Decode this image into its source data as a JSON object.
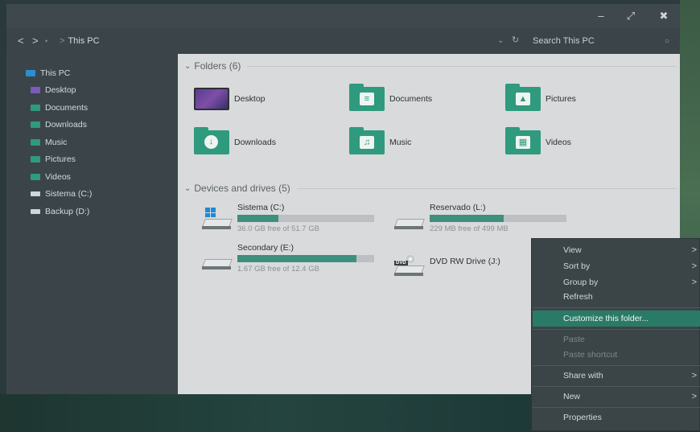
{
  "window": {
    "minimize": "–",
    "maximize": "⤢",
    "close": "✖"
  },
  "address": {
    "back": "<",
    "forward": ">",
    "up": "•",
    "sep": ">",
    "path": "This PC",
    "search_placeholder": "Search This PC"
  },
  "sidebar": {
    "items": [
      {
        "label": "This PC",
        "color": "#2a8fd0"
      },
      {
        "label": "Desktop",
        "color": "#7b5ac0"
      },
      {
        "label": "Documents",
        "color": "#2f9a7d"
      },
      {
        "label": "Downloads",
        "color": "#2f9a7d"
      },
      {
        "label": "Music",
        "color": "#2f9a7d"
      },
      {
        "label": "Pictures",
        "color": "#2f9a7d"
      },
      {
        "label": "Videos",
        "color": "#2f9a7d"
      },
      {
        "label": "Sistema (C:)",
        "color": "#d0d6d8"
      },
      {
        "label": "Backup (D:)",
        "color": "#d0d6d8"
      }
    ]
  },
  "folders": {
    "header": "Folders (6)",
    "items": [
      {
        "label": "Desktop",
        "icon": "desktop-icon"
      },
      {
        "label": "Documents",
        "icon": "document-icon"
      },
      {
        "label": "Pictures",
        "icon": "picture-icon"
      },
      {
        "label": "Downloads",
        "icon": "download-icon"
      },
      {
        "label": "Music",
        "icon": "music-icon"
      },
      {
        "label": "Videos",
        "icon": "video-icon"
      }
    ]
  },
  "drives": {
    "header": "Devices and drives (5)",
    "items": [
      {
        "name": "Sistema (C:)",
        "free": "36.0 GB free of 51.7 GB",
        "used_fraction": 0.3
      },
      {
        "name": "Reservado (L:)",
        "free": "229 MB free of 499 MB",
        "used_fraction": 0.54
      },
      {
        "name": "Secondary (E:)",
        "free": "1.67 GB free of 12.4 GB",
        "used_fraction": 0.87
      },
      {
        "name": "DVD RW Drive (J:)",
        "badge": "DVD"
      }
    ]
  },
  "context_menu": {
    "view": "View",
    "sort_by": "Sort by",
    "group_by": "Group by",
    "refresh": "Refresh",
    "customize": "Customize this folder...",
    "paste": "Paste",
    "paste_shortcut": "Paste shortcut",
    "share_with": "Share with",
    "new": "New",
    "properties": "Properties",
    "arrow": ">"
  },
  "colors": {
    "accent": "#2f9a7d",
    "menu_highlight": "#2a7a68"
  }
}
